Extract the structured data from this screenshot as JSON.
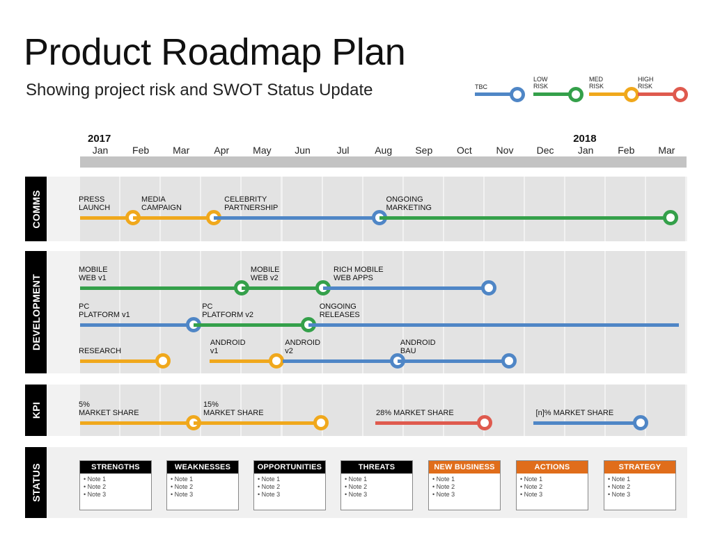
{
  "title": "Product Roadmap Plan",
  "subtitle": "Showing project risk and SWOT Status Update",
  "colors": {
    "tbc": "#4f86c6",
    "low": "#34a04a",
    "med": "#f0a81c",
    "high": "#df5a4e",
    "swot_dark": "#000000",
    "swot_orange": "#e06d1b"
  },
  "legend": [
    {
      "label": "TBC",
      "risk": "tbc"
    },
    {
      "label": "LOW\nRISK",
      "risk": "low"
    },
    {
      "label": "MED\nRISK",
      "risk": "med"
    },
    {
      "label": "HIGH\nRISK",
      "risk": "high"
    }
  ],
  "timeline": {
    "years": [
      {
        "label": "2017",
        "month_index": 0
      },
      {
        "label": "2018",
        "month_index": 12
      }
    ],
    "months": [
      "Jan",
      "Feb",
      "Mar",
      "Apr",
      "May",
      "Jun",
      "Jul",
      "Aug",
      "Sep",
      "Oct",
      "Nov",
      "Dec",
      "Jan",
      "Feb",
      "Mar"
    ]
  },
  "rows": [
    {
      "label": "COMMS",
      "tracks": [
        {
          "segments": [
            {
              "from": 0.0,
              "to": 1.3,
              "risk": "med",
              "label": "PRESS\nLAUNCH",
              "label_at": 0.0
            },
            {
              "from": 1.3,
              "to": 3.3,
              "risk": "med",
              "label": "MEDIA\nCAMPAIGN",
              "label_at": 1.55
            },
            {
              "from": 3.3,
              "to": 7.4,
              "risk": "tbc",
              "label": "CELEBRITY\nPARTNERSHIP",
              "label_at": 3.6
            },
            {
              "from": 7.4,
              "to": 14.6,
              "risk": "low",
              "label": "ONGOING\nMARKETING",
              "label_at": 7.6,
              "end_dot": true
            }
          ]
        }
      ]
    },
    {
      "label": "DEVELOPMENT",
      "tracks": [
        {
          "segments": [
            {
              "from": 0.0,
              "to": 4.0,
              "risk": "low",
              "label": "MOBILE\nWEB v1",
              "label_at": 0.0
            },
            {
              "from": 4.0,
              "to": 6.0,
              "risk": "low",
              "label": "MOBILE\nWEB v2",
              "label_at": 4.25
            },
            {
              "from": 6.0,
              "to": 10.1,
              "risk": "tbc",
              "label": "RICH MOBILE\nWEB APPS",
              "label_at": 6.3,
              "end_dot": true
            }
          ]
        },
        {
          "segments": [
            {
              "from": 0.0,
              "to": 2.8,
              "risk": "tbc",
              "label": "PC\nPLATFORM v1",
              "label_at": 0.0
            },
            {
              "from": 2.8,
              "to": 5.65,
              "risk": "low",
              "label": "PC\nPLATFORM v2",
              "label_at": 3.05
            },
            {
              "from": 5.65,
              "to": 14.8,
              "risk": "tbc",
              "label": "ONGOING\nRELEASES",
              "label_at": 5.95,
              "no_dot": true
            }
          ]
        },
        {
          "segments": [
            {
              "from": 0.0,
              "to": 2.05,
              "risk": "med",
              "label": "RESEARCH",
              "label_at": 0.0,
              "single_line": true
            },
            {
              "from": 3.2,
              "to": 4.85,
              "risk": "med",
              "label": "ANDROID\nv1",
              "label_at": 3.25
            },
            {
              "from": 5.0,
              "to": 7.85,
              "risk": "tbc",
              "label": "ANDROID\nv2",
              "label_at": 5.1
            },
            {
              "from": 7.85,
              "to": 10.6,
              "risk": "tbc",
              "label": "ANDROID\nBAU",
              "label_at": 7.95,
              "end_dot": true
            }
          ]
        }
      ]
    },
    {
      "label": "KPI",
      "tracks": [
        {
          "segments": [
            {
              "from": 0.0,
              "to": 2.8,
              "risk": "med",
              "label": "5%\nMARKET SHARE",
              "label_at": 0.0
            },
            {
              "from": 2.8,
              "to": 5.95,
              "risk": "med",
              "label": "15%\nMARKET SHARE",
              "label_at": 3.08,
              "end_dot": true
            },
            {
              "from": 7.3,
              "to": 10.0,
              "risk": "high",
              "label": "28% MARKET SHARE",
              "label_at": 7.35,
              "single_line": true,
              "end_dot": true
            },
            {
              "from": 11.2,
              "to": 13.85,
              "risk": "tbc",
              "label": "[n]% MARKET SHARE",
              "label_at": 11.3,
              "single_line": true,
              "end_dot": true
            }
          ]
        }
      ]
    }
  ],
  "status": {
    "label": "STATUS",
    "boxes": [
      {
        "title": "STRENGTHS",
        "style": "dark",
        "notes": [
          "Note 1",
          "Note 2",
          "Note 3"
        ]
      },
      {
        "title": "WEAKNESSES",
        "style": "dark",
        "notes": [
          "Note 1",
          "Note 2",
          "Note 3"
        ]
      },
      {
        "title": "OPPORTUNITIES",
        "style": "dark",
        "notes": [
          "Note 1",
          "Note 2",
          "Note 3"
        ]
      },
      {
        "title": "THREATS",
        "style": "dark",
        "notes": [
          "Note 1",
          "Note 2",
          "Note 3"
        ]
      },
      {
        "title": "NEW BUSINESS",
        "style": "orange",
        "notes": [
          "Note 1",
          "Note 2",
          "Note 3"
        ]
      },
      {
        "title": "ACTIONS",
        "style": "orange",
        "notes": [
          "Note 1",
          "Note 2",
          "Note 3"
        ]
      },
      {
        "title": "STRATEGY",
        "style": "orange",
        "notes": [
          "Note 1",
          "Note 2",
          "Note 3"
        ]
      }
    ]
  }
}
